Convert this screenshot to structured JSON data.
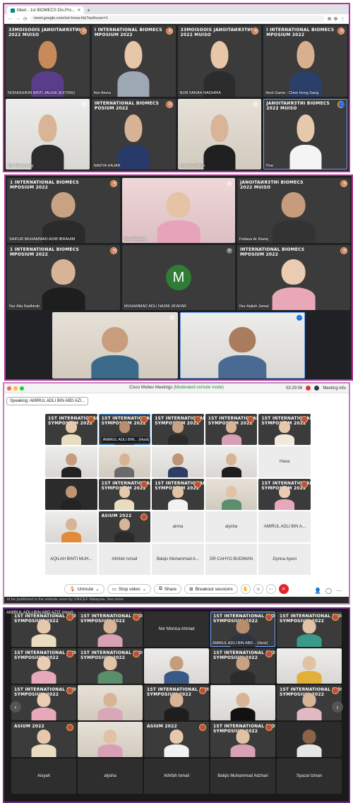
{
  "browser": {
    "tab_title": "Meet - 1st BIOMECS Dis.Pro...",
    "new_tab": "+",
    "url": "meet.google.com/xnt-hxxw-kfy?authuser=1"
  },
  "meet_top": {
    "tiles": [
      {
        "kind": "banner",
        "banner": "33MOISOOIS JAИOITAИЯ3TИI\n2022 MUISO",
        "name": "NORASHIKIN BINTI JALIUK (EXTINS)",
        "tint": [
          "#c98a5a",
          "#5a3d8a"
        ]
      },
      {
        "kind": "banner",
        "banner": "I INTERNATIONAL BIOMECS\nMPOSIUM 2022",
        "name": "Nor Ainna",
        "tint": [
          "#e8c6a8",
          "#9ea7b4"
        ]
      },
      {
        "kind": "banner",
        "banner": "33MOISOOIS JAИOITAИЯ3TИI\n2022 MUISO",
        "name": "NOR FARAH NADHIRA",
        "tint": [
          "#e8c6a8",
          "#2c2c2c"
        ]
      },
      {
        "kind": "banner",
        "banner": "I INTERNATIONAL BIOMECS\nMPOSIUM 2022",
        "name": "Next Game - Chee Hong Sang",
        "tint": [
          "#d8b090",
          "#2b3f6b"
        ]
      },
      {
        "kind": "wall",
        "banner": "",
        "name": "Tan Meng Ling",
        "tint": [
          "#d9b497",
          "#2d2d2d"
        ]
      },
      {
        "kind": "banner",
        "banner": "INTERNATIONAL BIOMECS\nPOSIUM 2022",
        "name": "NADYA HAJAR",
        "tint": [
          "#d8b295",
          "#273a6a"
        ]
      },
      {
        "kind": "room",
        "banner": "",
        "name": "nur ain nabilah",
        "tint": [
          "#d9b497",
          "#1f1f1f"
        ]
      },
      {
        "kind": "banner",
        "banner": "JANOITAИЯ3TИI BIOMECS\n2022 MUISO",
        "name": "Tina",
        "tint": [
          "#e6c9ad",
          "#f4f4f4"
        ],
        "selected": true
      }
    ]
  },
  "meet_gallery": {
    "tiles": [
      {
        "kind": "banner",
        "banner": "1 INTERNATIONAL BIOMECS\nMPOSIUM 2022",
        "name": "SAIFUR MUHAMMAD ADIB IBRAHIM",
        "tint": [
          "#c9a283",
          "#2b2b2b"
        ]
      },
      {
        "kind": "pink",
        "banner": "",
        "name": "Nur Hidayah",
        "tint": [
          "#e5c3a5",
          "#e6a4ba"
        ]
      },
      {
        "kind": "banner",
        "banner": "JANOITAИЯ3TИI BIOMECS\n2022 MUISO",
        "name": "Firdaus Ar Raziq",
        "tint": [
          "#c69c7c",
          "#333333"
        ]
      },
      {
        "kind": "banner",
        "banner": "1 INTERNATIONAL BIOMECS\nMPOSIUM 2022",
        "name": "Nur Aila Nadhirah",
        "tint": [
          "#d8b497",
          "#1e1e1e"
        ]
      },
      {
        "kind": "avatar",
        "banner": "",
        "name": "MUHAMMAD ADLI NAJMI JA'AFAR",
        "letter": "M"
      },
      {
        "kind": "banner",
        "banner": "INTERNATIONAL BIOMECS\nMPOSIUM 2022",
        "name": "Nur Aqilah Jamal",
        "tint": [
          "#e9ccb1",
          "#e8a8b8"
        ]
      },
      {
        "kind": "room",
        "banner": "",
        "name": "",
        "tint": [
          "#c89d7d",
          "#3b6a8a"
        ]
      },
      {
        "kind": "wall",
        "banner": "",
        "name": "",
        "tint": [
          "#a97c5d",
          "#4a6a94"
        ],
        "selected": true
      }
    ]
  },
  "webex": {
    "window_title": "Cisco Webex Meetings",
    "mode": "(Moderated unmute mode)",
    "clock": "03:29:06",
    "meeting_info": "Meeting info",
    "speaking_label": "Speaking:",
    "speaking_name": "AMIRUL ADLI BIN ABD AZI...",
    "tiles": [
      {
        "kind": "banner",
        "banner": "1ST INTERNATIONAL BIOMECS\nSYMPOSIUM 2022",
        "name": "",
        "tint": [
          "#e6c9ad",
          "#e9dcc0"
        ]
      },
      {
        "kind": "banner",
        "banner": "1ST INTERNATIONAL BIOMECS\nSYMPOSIUM 2022",
        "name": "AMIRUL ADLI BIN... (Host)",
        "tint": [
          "#b88e6e",
          "#2f3540"
        ],
        "selected": true
      },
      {
        "kind": "banner",
        "banner": "1ST INTERNATIONAL BIOMECS\nSYMPOSIUM 2022",
        "name": "",
        "tint": [
          "#c9a283",
          "#2b2b2b"
        ]
      },
      {
        "kind": "banner",
        "banner": "1ST INTERNATIONAL BIOMECS\nSYMPOSIUM 2022",
        "name": "",
        "tint": [
          "#d8b497",
          "#d7a0b4"
        ]
      },
      {
        "kind": "banner",
        "banner": "1ST INTERNATIONAL BIOMECS\nSYMPOSIUM 2022",
        "name": "",
        "tint": [
          "#e6c9ad",
          "#f2e9dc"
        ]
      },
      {
        "kind": "wall",
        "banner": "",
        "name": "",
        "tint": [
          "#c69c7c",
          "#222222"
        ]
      },
      {
        "kind": "room",
        "banner": "",
        "name": "",
        "tint": [
          "#d8b497",
          "#6a6a6a"
        ]
      },
      {
        "kind": "wall",
        "banner": "",
        "name": "",
        "tint": [
          "#bf9474",
          "#2d3d63"
        ]
      },
      {
        "kind": "wall",
        "banner": "",
        "name": "",
        "tint": [
          "#d8b497",
          "#1e1e1e"
        ]
      },
      {
        "kind": "grey",
        "banner": "",
        "name": "Hana"
      },
      {
        "kind": "dark",
        "banner": "",
        "name": "",
        "tint": [
          "#bf9474",
          "#232323"
        ]
      },
      {
        "kind": "banner",
        "banner": "1ST INTERNATIONAL BIOMECS\nSYMPOSIUM 2022",
        "name": "",
        "tint": [
          "#e6c9ad",
          "#e9dcc0"
        ]
      },
      {
        "kind": "banner",
        "banner": "1ST INTERNATIONAL BIOMECS\nSYMPOSIUM 2022",
        "name": "",
        "tint": [
          "#e1c2a4",
          "#f2f2f2"
        ]
      },
      {
        "kind": "room",
        "banner": "",
        "name": "",
        "tint": [
          "#e2c3a6",
          "#5b8e6a"
        ]
      },
      {
        "kind": "banner",
        "banner": "1ST INTERNATIONAL BIOMECS\nSYMPOSIUM 2022",
        "name": "",
        "tint": [
          "#e9ccb1",
          "#e7a9b9"
        ]
      },
      {
        "kind": "wall",
        "banner": "",
        "name": "",
        "tint": [
          "#d8b497",
          "#e08a3a"
        ]
      },
      {
        "kind": "banner",
        "banner": "ASIUM 2022",
        "name": "",
        "tint": [
          "#d8b497",
          "#2a2a2a"
        ]
      },
      {
        "kind": "grey",
        "banner": "",
        "name": "ainna"
      },
      {
        "kind": "grey",
        "banner": "",
        "name": "alysha"
      },
      {
        "kind": "grey",
        "banner": "",
        "name": "AMIRUL ADLI BIN A..."
      },
      {
        "kind": "grey",
        "banner": "",
        "name": "AQILAH BINTI MUH..."
      },
      {
        "kind": "grey",
        "banner": "",
        "name": "Athifah Ismail"
      },
      {
        "kind": "grey",
        "banner": "",
        "name": "Balqis Muhammad A..."
      },
      {
        "kind": "grey",
        "banner": "",
        "name": "DR CAHYO BUDIMAN"
      },
      {
        "kind": "grey",
        "banner": "",
        "name": "Dynna Ayuni"
      }
    ],
    "controls": {
      "unmute": "Unmute",
      "stop_video": "Stop video",
      "share": "Share",
      "breakout": "Breakout sessions"
    },
    "footer": "ld be published in the website soon by UNICEF Malaysia.   See more"
  },
  "zoom": {
    "host_label": "AMIRUL ADLI BIN ABD AZIZ (Host)",
    "tiles": [
      {
        "kind": "banner",
        "banner": "1ST INTERNATIONAL BIOMECS\nSYMPOSIUM 2022",
        "name": "",
        "tint": [
          "#e6c9ad",
          "#e9dcc0"
        ]
      },
      {
        "kind": "banner",
        "banner": "1ST INTERNATIONAL BIOMECS\nSYMPOSIUM 2022",
        "name": "",
        "tint": [
          "#d8b497",
          "#d7a0b4"
        ]
      },
      {
        "kind": "plain",
        "banner": "",
        "name": "",
        "center": "Nor Monica Ahmad"
      },
      {
        "kind": "banner",
        "banner": "1ST INTERNATIONAL BIOMECS\nSYMPOSIUM 2022",
        "name": "AMIRUL ADLI BIN ABD... (Host)",
        "tint": [
          "#b88e6e",
          "#2f3540"
        ],
        "selected": true
      },
      {
        "kind": "banner",
        "banner": "1ST INTERNATIONAL BIOMECS\nSYMPOSIUM 2022",
        "name": "",
        "tint": [
          "#e1c2a4",
          "#3a9a8a"
        ]
      },
      {
        "kind": "banner",
        "banner": "1ST INTERNATIONAL BIOMECS\nSYMPOSIUM 2022",
        "name": "",
        "tint": [
          "#e9ccb1",
          "#e7a9b9"
        ]
      },
      {
        "kind": "banner",
        "banner": "1ST INTERNATIONAL BIOMECS\nSYMPOSIUM 2022",
        "name": "",
        "tint": [
          "#e2c3a6",
          "#5b8e6a"
        ]
      },
      {
        "kind": "wall",
        "banner": "",
        "name": "",
        "tint": [
          "#c69c7c",
          "#3a5a86"
        ]
      },
      {
        "kind": "banner",
        "banner": "1ST INTERNATIONAL BIOMECS\nSYMPOSIUM 2022",
        "name": "",
        "tint": [
          "#c9a283",
          "#2b2b2b"
        ]
      },
      {
        "kind": "wall",
        "banner": "",
        "name": "",
        "tint": [
          "#e1c2a4",
          "#e2b03a"
        ]
      },
      {
        "kind": "banner",
        "banner": "1ST INTERNATIONAL BIOMECS\nSYMPOSIUM 2022",
        "name": "",
        "tint": [
          "#e9ccb1",
          "#e7a9b9"
        ]
      },
      {
        "kind": "room",
        "banner": "",
        "name": "",
        "tint": [
          "#d8b497",
          "#d9a7b8"
        ]
      },
      {
        "kind": "banner",
        "banner": "1ST INTERNATIONAL BIOMECS\nSYMPOSIUM 2022",
        "name": "",
        "tint": [
          "#d8b497",
          "#1e1e1e"
        ]
      },
      {
        "kind": "wall",
        "banner": "",
        "name": "",
        "tint": [
          "#d8b497",
          "#111111"
        ]
      },
      {
        "kind": "banner",
        "banner": "1ST INTERNATIONAL BIOMECS\nSYMPOSIUM 2022",
        "name": "",
        "tint": [
          "#d8b497",
          "#e0b9c2"
        ]
      },
      {
        "kind": "banner",
        "banner": "ASIUM 2022",
        "name": "",
        "tint": [
          "#e6c9ad",
          "#e9dcc0"
        ]
      },
      {
        "kind": "room",
        "banner": "",
        "name": "",
        "tint": [
          "#e1c2a4",
          "#d7a0b4"
        ]
      },
      {
        "kind": "banner",
        "banner": "ASIUM 2022",
        "name": "",
        "tint": [
          "#e6c9ad",
          "#f2f2f2"
        ]
      },
      {
        "kind": "banner",
        "banner": "1ST INTERNATIONAL BIOMECS\nSYMPOSIUM 2022",
        "name": "",
        "tint": [
          "#e1c2a4",
          "#d7a0b4"
        ]
      },
      {
        "kind": "dark",
        "banner": "",
        "name": "",
        "tint": [
          "#8a6448",
          "#e6e6e6"
        ]
      },
      {
        "kind": "plain",
        "banner": "",
        "name": "",
        "center": "Aisyah"
      },
      {
        "kind": "plain",
        "banner": "",
        "name": "",
        "center": "alysha"
      },
      {
        "kind": "plain",
        "banner": "",
        "name": "",
        "center": "Athifah Ismail"
      },
      {
        "kind": "plain",
        "banner": "",
        "name": "",
        "center": "Balqis Muhammad Adzhari"
      },
      {
        "kind": "plain",
        "banner": "",
        "name": "",
        "center": "Syazal Izman"
      }
    ]
  }
}
